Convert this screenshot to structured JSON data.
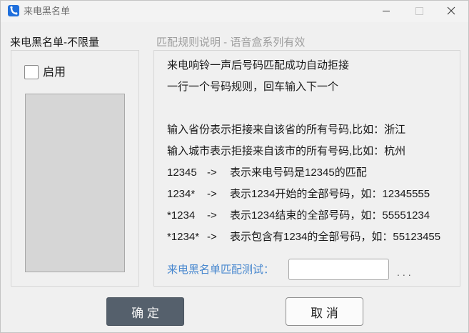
{
  "window": {
    "title": "来电黑名单"
  },
  "icons": {
    "app": "phone-app-icon",
    "minimize": "minimize-icon",
    "maximize": "maximize-icon",
    "close": "close-icon"
  },
  "blacklist": {
    "heading": "来电黑名单-不限量",
    "enable_label": "启用",
    "enabled": false
  },
  "rules": {
    "heading": "匹配规则说明 - 语音盒系列有效",
    "intro": [
      "来电响铃一声后号码匹配成功自动拒接",
      "一行一个号码规则，回车输入下一个"
    ],
    "region_rules": [
      "输入省份表示拒接来自该省的所有号码,比如：浙江",
      "输入城市表示拒接来自该市的所有号码,比如：杭州"
    ],
    "pattern_rules": [
      {
        "pattern": "12345",
        "arrow": "->",
        "description": "表示来电号码是12345的匹配"
      },
      {
        "pattern": "1234*",
        "arrow": "->",
        "description": "表示1234开始的全部号码，如：12345555"
      },
      {
        "pattern": "*1234",
        "arrow": "->",
        "description": "表示1234结束的全部号码，如：55551234"
      },
      {
        "pattern": "*1234*",
        "arrow": "->",
        "description": "表示包含有1234的全部号码，如：55123455"
      }
    ]
  },
  "match_test": {
    "label": "来电黑名单匹配测试：",
    "result": "..."
  },
  "buttons": {
    "ok": "确 定",
    "cancel": "取 消"
  },
  "colors": {
    "window_bg": "#f0f0f0",
    "accent_blue": "#4a89cf",
    "ok_button": "#55606c",
    "muted_text": "#9e9e9e",
    "disabled_field": "#d6d6d6",
    "app_icon": "#1f6fdc"
  }
}
